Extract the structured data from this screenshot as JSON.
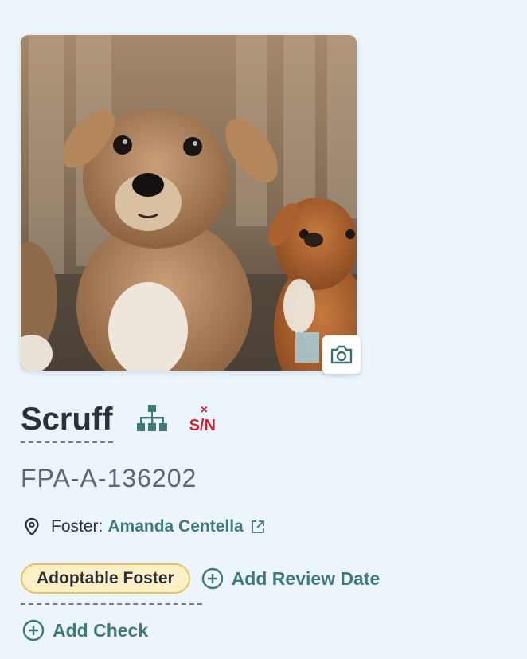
{
  "animal": {
    "name": "Scruff",
    "id": "FPA-A-136202",
    "sn_badge_mark": "×",
    "sn_badge_text": "S/N"
  },
  "foster": {
    "label": "Foster:",
    "name": "Amanda Centella"
  },
  "status": {
    "label": "Adoptable Foster"
  },
  "actions": {
    "add_review_date": "Add Review Date",
    "add_check": "Add Check"
  },
  "icons": {
    "camera": "camera-icon",
    "family_tree": "family-tree-icon",
    "location": "map-pin-icon",
    "external_link": "external-link-icon",
    "add": "plus-circle-icon"
  },
  "colors": {
    "background": "#ecf4fc",
    "accent_teal": "#3f7a78",
    "badge_red": "#d61f2c",
    "status_fill": "#fbefc6",
    "status_border": "#e8c25f"
  }
}
